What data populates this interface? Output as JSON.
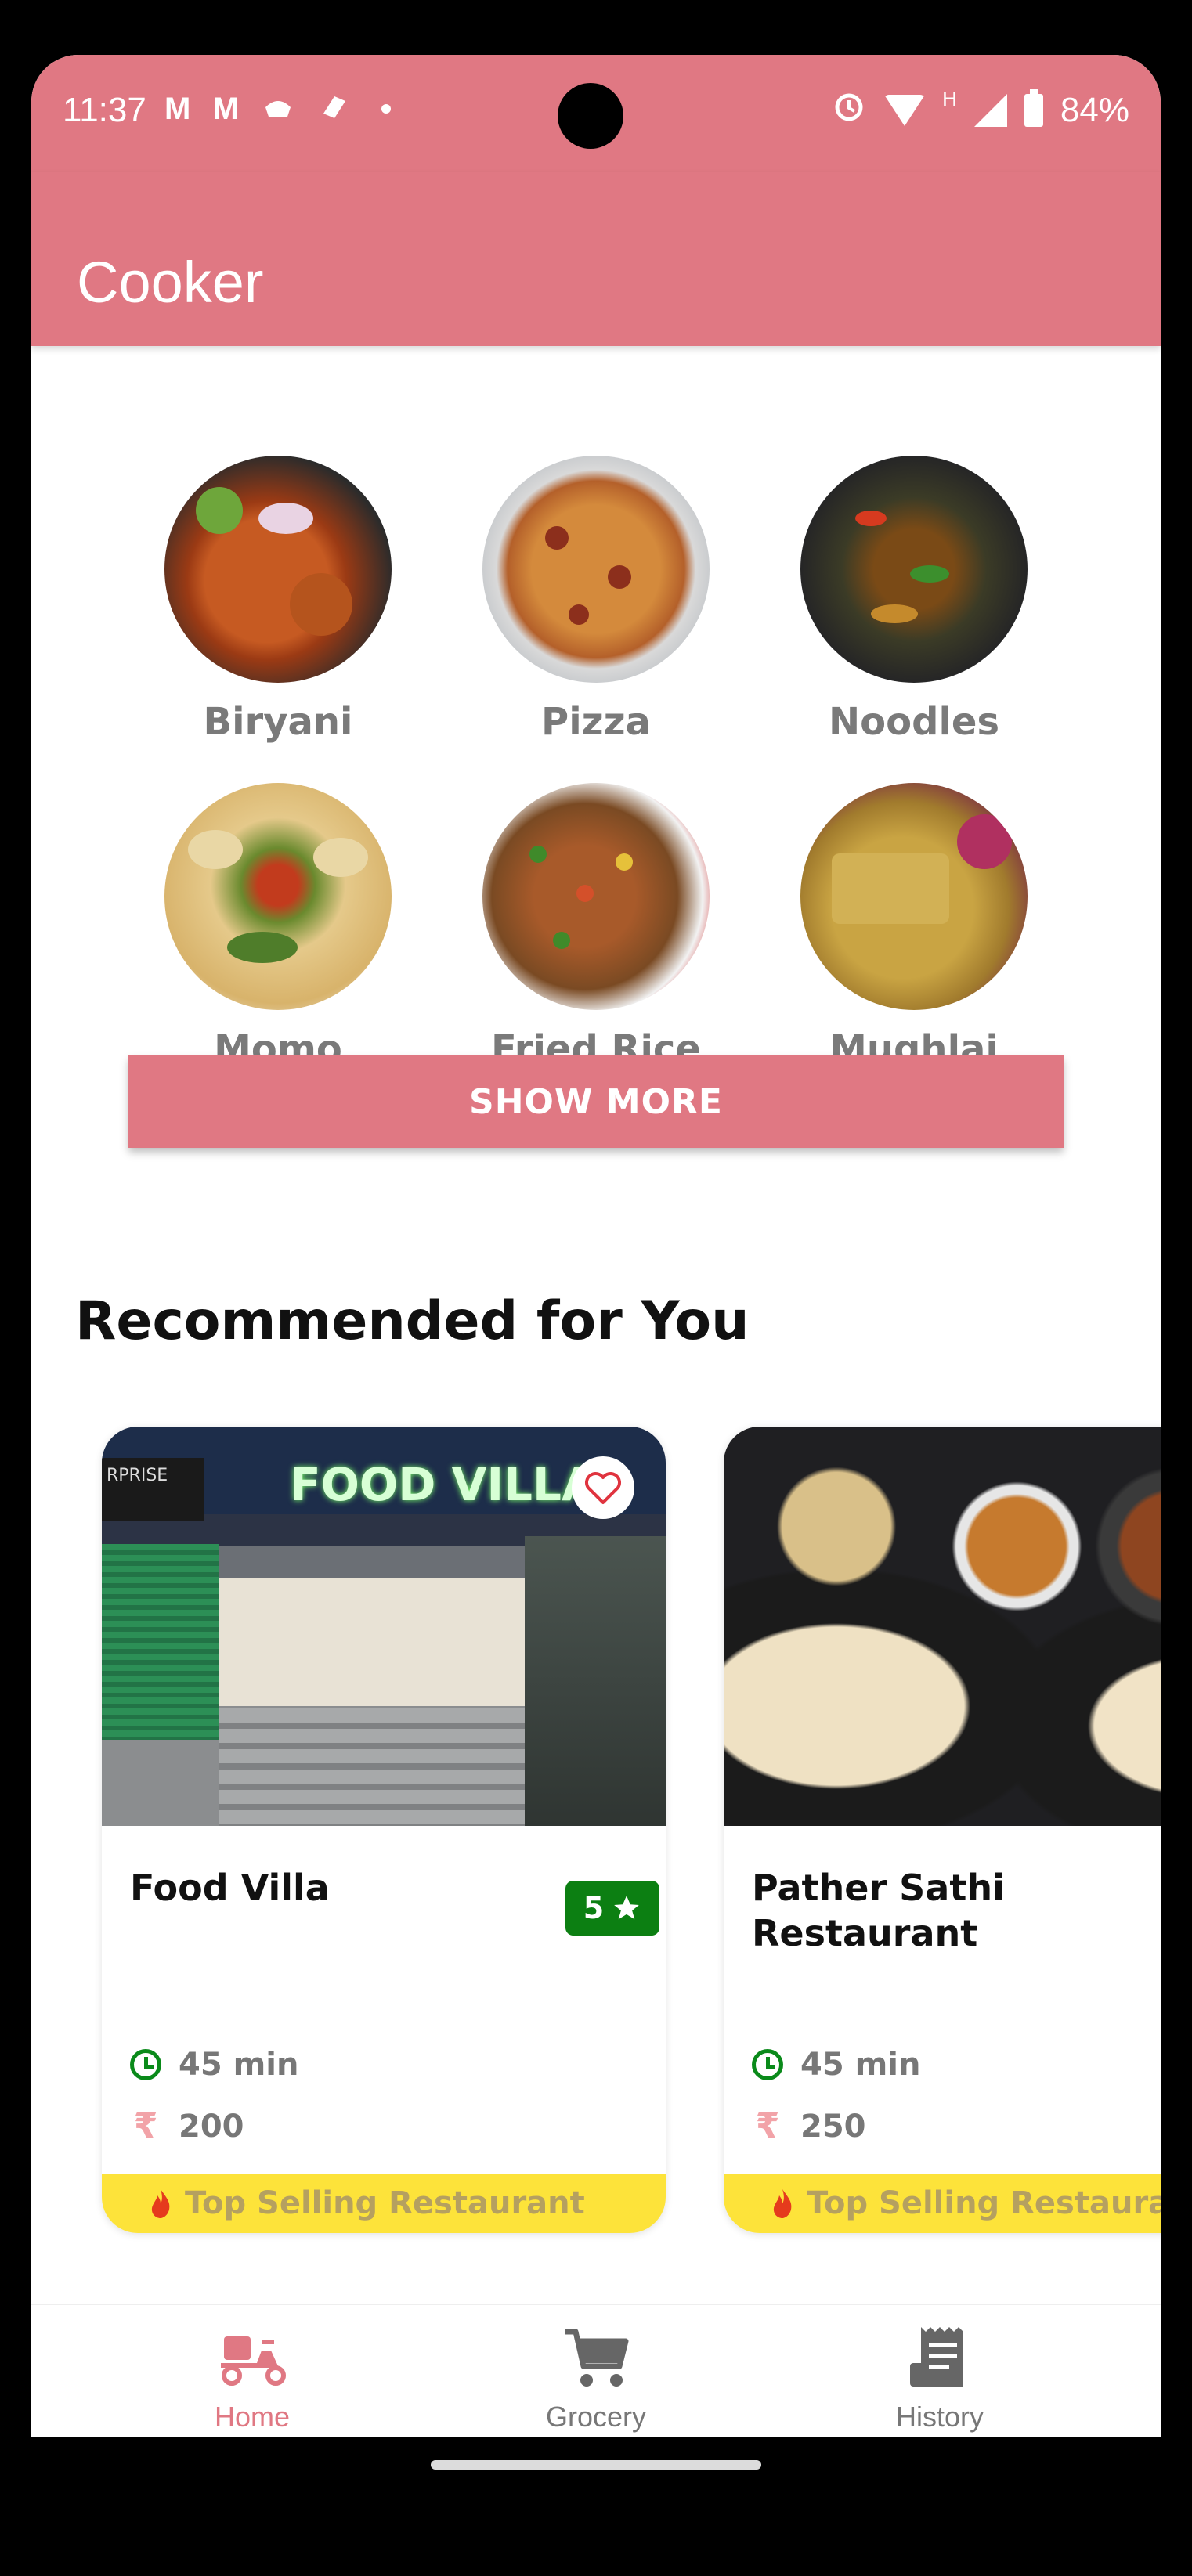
{
  "status_bar": {
    "time": "11:37",
    "battery": "84%",
    "network_label": "H"
  },
  "app": {
    "title": "Cooker",
    "accent_color": "#e07883"
  },
  "categories": [
    {
      "label": "Biryani",
      "icon": "biryani-image"
    },
    {
      "label": "Pizza",
      "icon": "pizza-image"
    },
    {
      "label": "Noodles",
      "icon": "noodles-image"
    },
    {
      "label": "Momo",
      "icon": "momo-image"
    },
    {
      "label": "Fried Rice",
      "icon": "fried-rice-image"
    },
    {
      "label": "Mughlai",
      "icon": "mughlai-image"
    }
  ],
  "show_more_label": "SHOW MORE",
  "recommended": {
    "title": "Recommended for You",
    "cards": [
      {
        "name": "Food Villa",
        "storefront_sign": "FOOD VILLA",
        "rating": "5",
        "time": "45 min",
        "price": "200",
        "badge": "Top Selling Restaurant",
        "favorite": false
      },
      {
        "name": "Pather Sathi Restaurant",
        "time": "45 min",
        "price": "250",
        "badge": "Top Selling Restaurant"
      }
    ]
  },
  "bottom_nav": [
    {
      "label": "Home",
      "icon": "scooter-icon",
      "active": true
    },
    {
      "label": "Grocery",
      "icon": "cart-icon",
      "active": false
    },
    {
      "label": "History",
      "icon": "receipt-icon",
      "active": false
    }
  ]
}
